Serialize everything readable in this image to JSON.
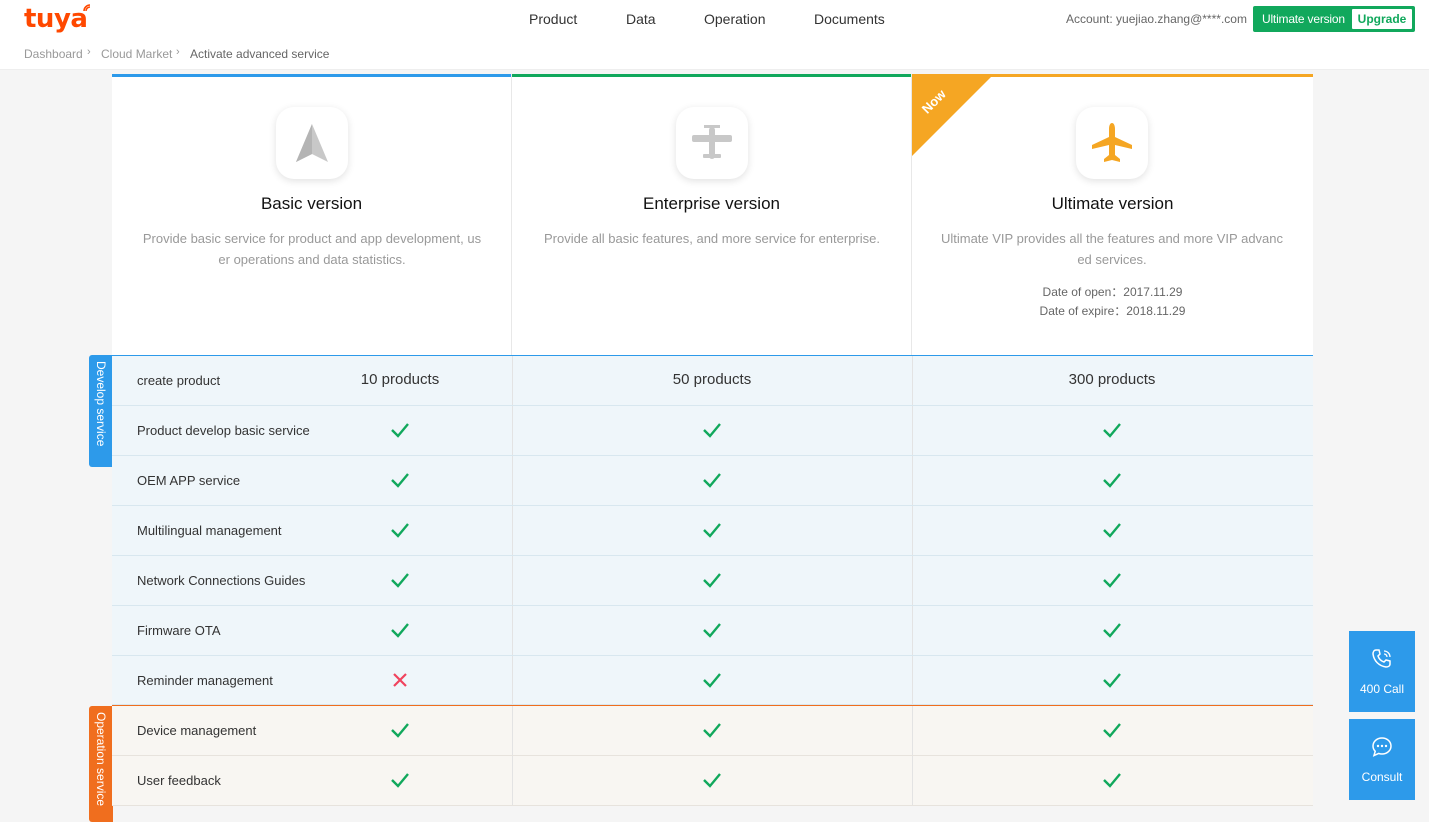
{
  "header": {
    "logo": "tuya",
    "nav": [
      "Product",
      "Data",
      "Operation",
      "Documents"
    ],
    "account": "Account: yuejiao.zhang@****.com",
    "current_version": "Ultimate version",
    "upgrade": "Upgrade"
  },
  "breadcrumb": [
    "Dashboard",
    "Cloud Market",
    "Activate advanced service"
  ],
  "plans": [
    {
      "name": "Basic version",
      "description": "Provide basic service for product and app development, user operations and data statistics.",
      "icon": "paper-plane-icon",
      "accent": "#2d9aea"
    },
    {
      "name": "Enterprise version",
      "description": "Provide all basic features, and more service for enterprise.",
      "icon": "propeller-plane-icon",
      "accent": "#11a85c"
    },
    {
      "name": "Ultimate version",
      "description": "Ultimate VIP provides all the features and more VIP advanced services.",
      "icon": "airplane-icon",
      "accent": "#f5a623",
      "badge": "Now",
      "date_open": "Date of open：2017.11.29",
      "date_expire": "Date of expire：2018.11.29"
    }
  ],
  "sections": [
    {
      "name": "Develop service",
      "color": "#2d9aea",
      "features": [
        {
          "name": "create product",
          "basic": "10 products",
          "enterprise": "50 products",
          "ultimate": "300 products"
        },
        {
          "name": "Product develop basic service",
          "basic": true,
          "enterprise": true,
          "ultimate": true
        },
        {
          "name": "OEM APP service",
          "basic": true,
          "enterprise": true,
          "ultimate": true
        },
        {
          "name": "Multilingual management",
          "basic": true,
          "enterprise": true,
          "ultimate": true
        },
        {
          "name": "Network Connections Guides",
          "basic": true,
          "enterprise": true,
          "ultimate": true
        },
        {
          "name": "Firmware OTA",
          "basic": true,
          "enterprise": true,
          "ultimate": true
        },
        {
          "name": "Reminder management",
          "basic": false,
          "enterprise": true,
          "ultimate": true
        }
      ]
    },
    {
      "name": "Operation service",
      "color": "#f06e1e",
      "features": [
        {
          "name": "Device management",
          "basic": true,
          "enterprise": true,
          "ultimate": true
        },
        {
          "name": "User feedback",
          "basic": true,
          "enterprise": true,
          "ultimate": true
        }
      ]
    }
  ],
  "side_buttons": [
    {
      "label": "400 Call",
      "icon": "phone-icon"
    },
    {
      "label": "Consult",
      "icon": "chat-icon"
    }
  ],
  "colors": {
    "check": "#11a85c",
    "cross": "#f0435d",
    "brand": "#ff4800"
  }
}
